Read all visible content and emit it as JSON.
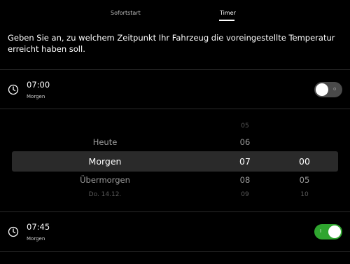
{
  "tabs": [
    {
      "label": "Sofortstart"
    },
    {
      "label": "Timer"
    }
  ],
  "description": "Geben Sie an, zu welchem Zeitpunkt Ihr Fahrzeug die voreingestellte Temperatur erreicht haben soll.",
  "timers": [
    {
      "time": "07:00",
      "day": "Morgen",
      "enabled": false,
      "toggle_mark": "o"
    },
    {
      "time": "07:45",
      "day": "Morgen",
      "enabled": true,
      "toggle_mark": "I"
    }
  ],
  "picker": {
    "days": [
      "Heute",
      "Morgen",
      "Übermorgen",
      "Do. 14.12."
    ],
    "hours": [
      "05",
      "06",
      "07",
      "08",
      "09"
    ],
    "minutes": [
      "00",
      "05",
      "10"
    ],
    "selected": {
      "day": "Morgen",
      "hour": "07",
      "minute": "00"
    }
  },
  "colors": {
    "background": "#000000",
    "toggle_on": "#2fa52f",
    "toggle_off": "#4a4a4a",
    "highlight": "#2a2a2a"
  }
}
